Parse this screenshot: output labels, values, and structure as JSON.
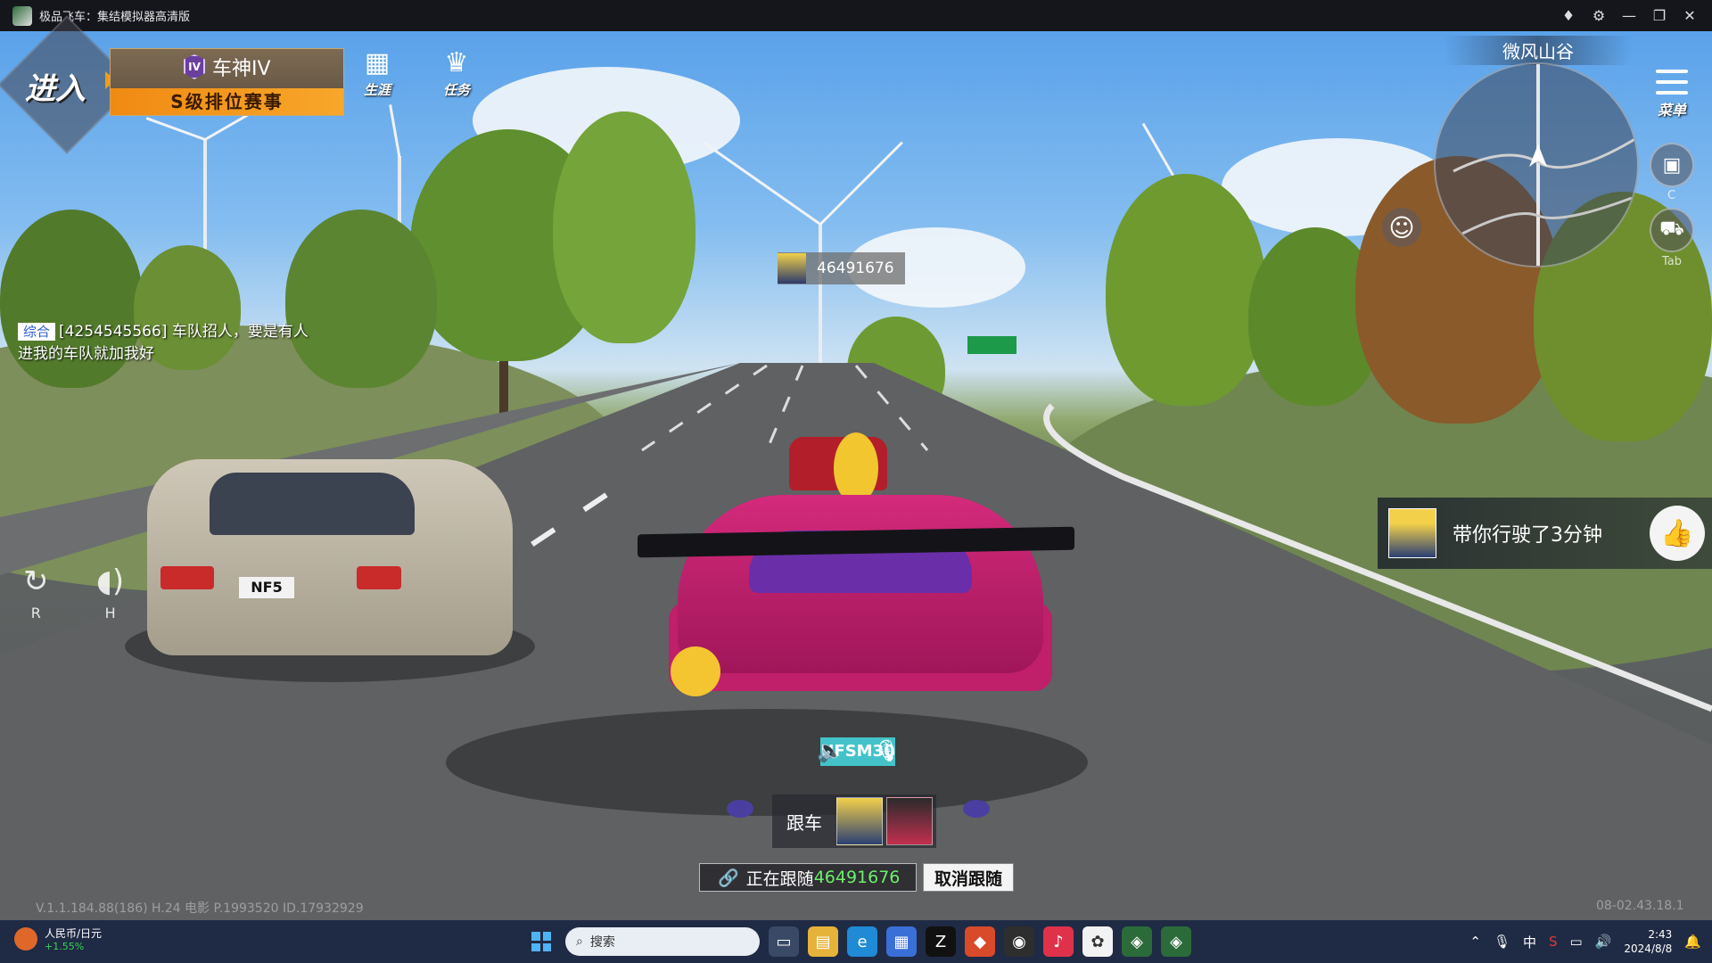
{
  "window": {
    "title": "极品飞车：集结模拟器高清版",
    "controls": [
      "—",
      "❐",
      "✕"
    ],
    "extra_icons": [
      "gem-icon",
      "gear-icon"
    ]
  },
  "hud": {
    "enter_label": "进入",
    "rank": {
      "badge": "IV",
      "name": "车神IV",
      "event": "S级排位赛事"
    },
    "buttons": [
      {
        "icon": "calendar-icon",
        "label": "生涯"
      },
      {
        "icon": "crown-icon",
        "label": "任务"
      }
    ],
    "map_name": "微风山谷",
    "menu_label": "菜单",
    "side_keys": {
      "c": "C",
      "tab": "Tab"
    },
    "left_controls": [
      {
        "icon": "reset-icon",
        "key": "R"
      },
      {
        "icon": "horn-icon",
        "key": "H"
      }
    ]
  },
  "chat": {
    "channel": "综合",
    "message": "[4254545566] 车队招人，要是有人进我的车队就加我好"
  },
  "player_tag": {
    "id": "46491676"
  },
  "notification": {
    "text": "带你行驶了3分钟"
  },
  "follow": {
    "label": "跟车",
    "status_prefix": "正在跟随",
    "status_id": "46491676",
    "cancel_label": "取消跟随"
  },
  "footer": {
    "version": "V.1.1.184.88(186) H.24 电影 P.1993520 ID.17932929",
    "build": "08-02.43.18.1"
  },
  "scene": {
    "plates": {
      "player": "NFSM30",
      "rival": "NF5"
    }
  },
  "taskbar": {
    "weather_title": "人民币/日元",
    "weather_change": "+1.55%",
    "search_placeholder": "搜索",
    "ime": "中",
    "time": "2:43",
    "date": "2024/8/8"
  }
}
